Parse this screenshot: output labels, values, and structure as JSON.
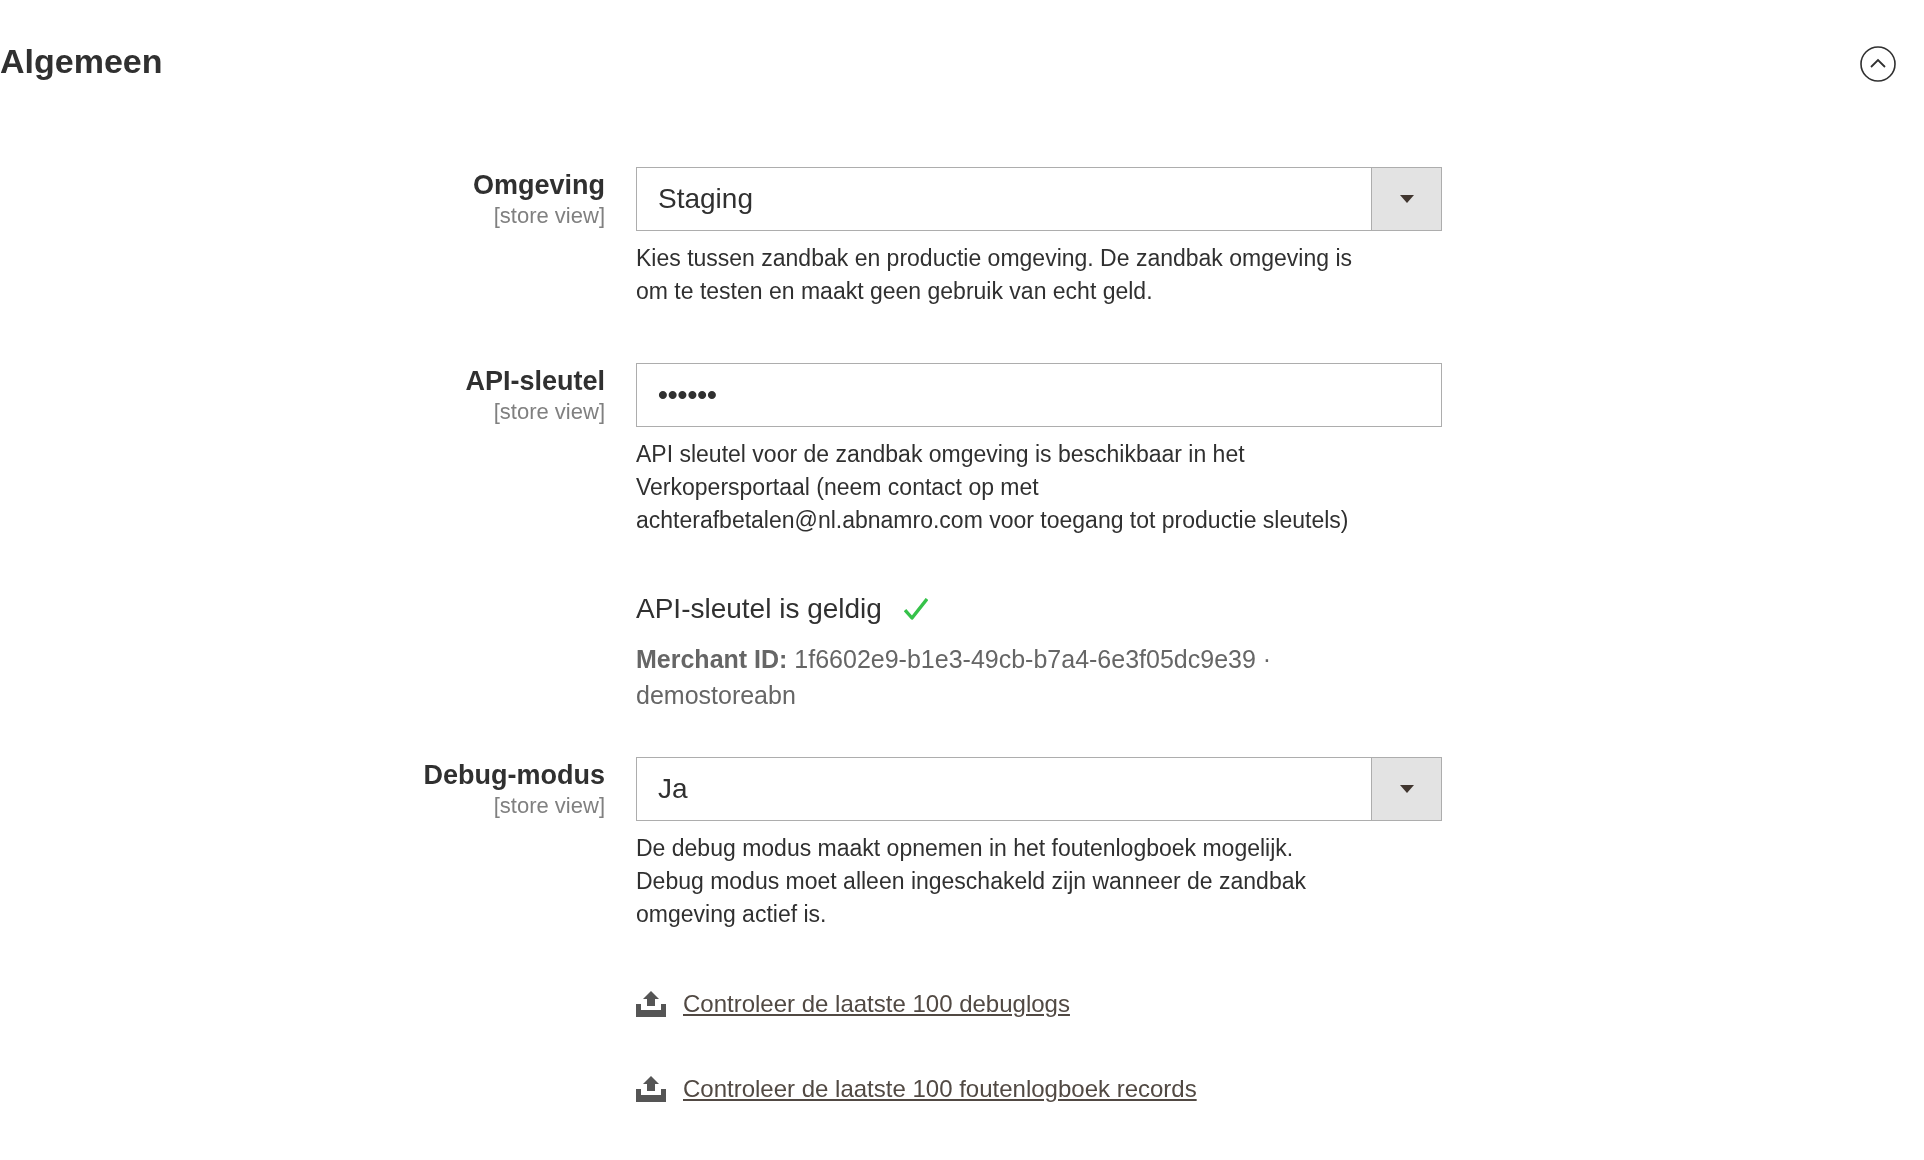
{
  "section": {
    "title": "Algemeen",
    "expanded": true
  },
  "fields": [
    {
      "kind": "select",
      "label": "Omgeving",
      "scope": "[store view]",
      "value": "Staging",
      "help": [
        "Kies tussen zandbak en productie omgeving. De zandbak omgeving is",
        "om te testen en maakt geen gebruik van echt geld."
      ]
    },
    {
      "kind": "password",
      "label": "API-sleutel",
      "scope": "[store view]",
      "value": "••••••",
      "help": [
        "API sleutel voor de zandbak omgeving is beschikbaar in het",
        "Verkopersportaal (neem contact op met",
        "achterafbetalen@nl.abnamro.com voor toegang tot productie sleutels)"
      ]
    },
    {
      "kind": "status",
      "status": "API-sleutel is geldig",
      "valid": true,
      "details": [
        "**Merchant ID:** 1f6602e9-b1e3-49cb-b7a4-6e3f05dc9e39 ·",
        "demostoreabn"
      ]
    },
    {
      "kind": "select",
      "label": "Debug-modus",
      "scope": "[store view]",
      "value": "Ja",
      "help": [
        "De debug modus maakt opnemen in het foutenlogboek mogelijk.",
        "Debug modus moet alleen ingeschakeld zijn wanneer de zandbak",
        "omgeving actief is."
      ]
    }
  ],
  "links": [
    "Controleer de laatste 100 debuglogs",
    "Controleer de laatste 100 foutenlogboek records"
  ]
}
